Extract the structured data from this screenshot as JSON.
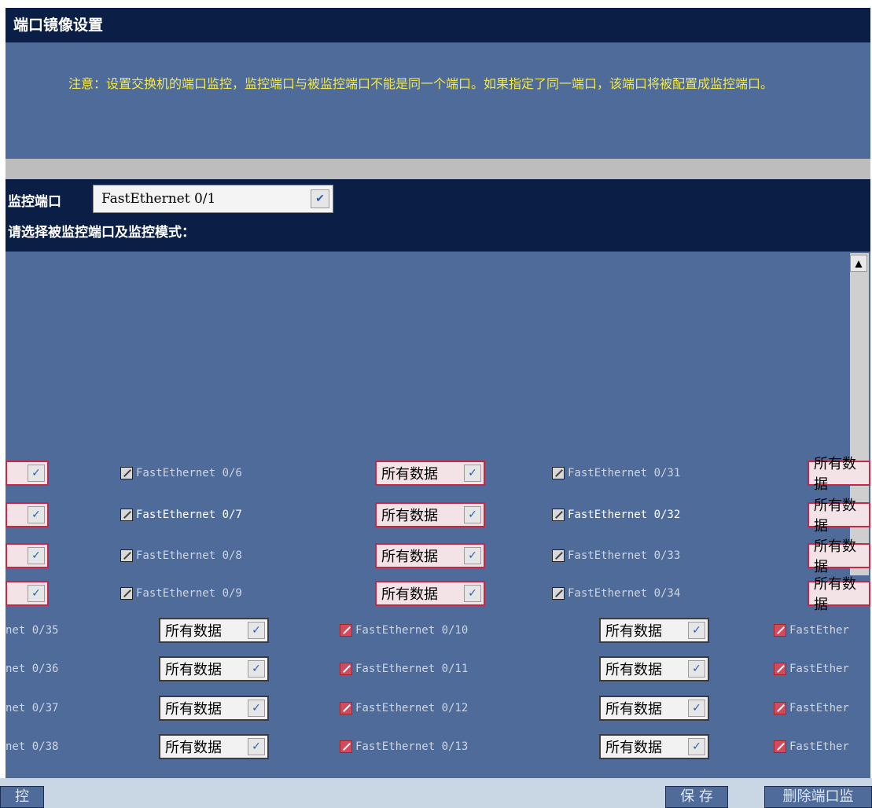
{
  "title": "端口镜像设置",
  "notice": "注意：设置交换机的端口监控，监控端口与被监控端口不能是同一个端口。如果指定了同一端口，该端口将被配置成监控端口。",
  "monitor": {
    "label": "监控端口",
    "value": "FastEthernet 0/1"
  },
  "select_label": "请选择被监控端口及监控模式：",
  "mode_text": "所有数据",
  "rows": [
    {
      "port_a": "FastEthernet 0/6",
      "port_b": "FastEthernet 0/31"
    },
    {
      "port_a": "FastEthernet 0/7",
      "port_b": "FastEthernet 0/32"
    },
    {
      "port_a": "FastEthernet 0/8",
      "port_b": "FastEthernet 0/33"
    },
    {
      "port_a": "FastEthernet 0/9",
      "port_b": "FastEthernet 0/34"
    }
  ],
  "rows2": [
    {
      "left": "net 0/35",
      "middle": "FastEthernet 0/10",
      "right": "FastEther"
    },
    {
      "left": "net 0/36",
      "middle": "FastEthernet 0/11",
      "right": "FastEther"
    },
    {
      "left": "net 0/37",
      "middle": "FastEthernet 0/12",
      "right": "FastEther"
    },
    {
      "left": "net 0/38",
      "middle": "FastEthernet 0/13",
      "right": "FastEther"
    }
  ],
  "buttons": {
    "left": "控",
    "save": "保 存",
    "delete": "删除端口监"
  },
  "colors": {
    "title_bg": "#0b1e45",
    "panel_bg": "#4f6b9a",
    "notice_text": "#f2e84a"
  }
}
